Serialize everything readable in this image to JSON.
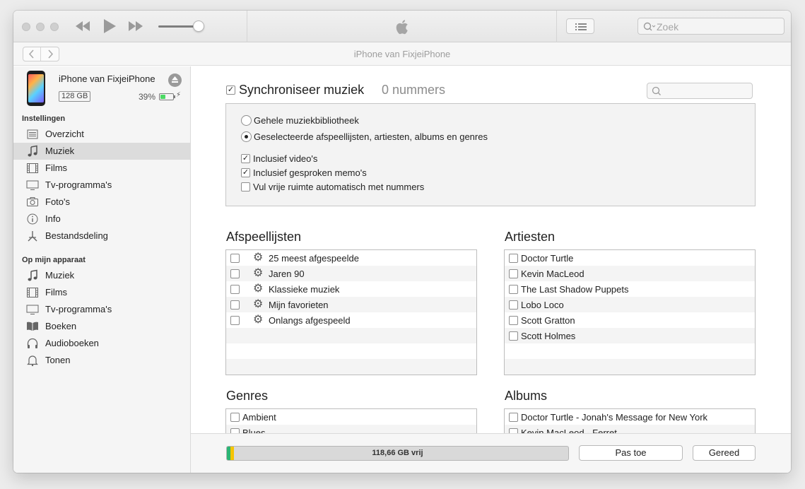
{
  "toolbar": {
    "search_placeholder": "Zoek",
    "volume_level": 0.95
  },
  "navbar": {
    "title": "iPhone van FixjeiPhone",
    "back_icon": "chevron-left-icon",
    "forward_icon": "chevron-right-icon"
  },
  "device": {
    "name": "iPhone van FixjeiPhone",
    "capacity": "128 GB",
    "battery_percent": "39%",
    "battery_level": 0.39
  },
  "sidebar": {
    "settings_heading": "Instellingen",
    "settings_items": [
      {
        "label": "Overzicht",
        "icon": "list-icon"
      },
      {
        "label": "Muziek",
        "icon": "music-note-icon",
        "selected": true
      },
      {
        "label": "Films",
        "icon": "film-icon"
      },
      {
        "label": "Tv-programma's",
        "icon": "tv-icon"
      },
      {
        "label": "Foto's",
        "icon": "camera-icon"
      },
      {
        "label": "Info",
        "icon": "info-icon"
      },
      {
        "label": "Bestandsdeling",
        "icon": "app-sharing-icon"
      }
    ],
    "device_heading": "Op mijn apparaat",
    "device_items": [
      {
        "label": "Muziek",
        "icon": "music-note-icon"
      },
      {
        "label": "Films",
        "icon": "film-icon"
      },
      {
        "label": "Tv-programma's",
        "icon": "tv-icon"
      },
      {
        "label": "Boeken",
        "icon": "book-icon"
      },
      {
        "label": "Audioboeken",
        "icon": "headphones-icon"
      },
      {
        "label": "Tonen",
        "icon": "bell-icon"
      }
    ]
  },
  "main": {
    "sync_label": "Synchroniseer muziek",
    "sync_checked": true,
    "sync_count": "0 nummers",
    "radio_options": [
      {
        "label": "Gehele muziekbibliotheek",
        "selected": false
      },
      {
        "label": "Geselecteerde afspeellijsten, artiesten, albums en genres",
        "selected": true
      }
    ],
    "check_options": [
      {
        "label": "Inclusief video's",
        "checked": true
      },
      {
        "label": "Inclusief gesproken memo's",
        "checked": true
      },
      {
        "label": "Vul vrije ruimte automatisch met nummers",
        "checked": false
      }
    ],
    "playlists": {
      "title": "Afspeellijsten",
      "items": [
        "25 meest afgespeelde",
        "Jaren 90",
        "Klassieke muziek",
        "Mijn favorieten",
        "Onlangs afgespeeld"
      ]
    },
    "artists": {
      "title": "Artiesten",
      "items": [
        "Doctor Turtle",
        "Kevin MacLeod",
        "The Last Shadow Puppets",
        "Lobo Loco",
        "Scott Gratton",
        "Scott Holmes"
      ]
    },
    "genres": {
      "title": "Genres",
      "items": [
        "Ambient",
        "Blues"
      ]
    },
    "albums": {
      "title": "Albums",
      "items": [
        "Doctor Turtle - Jonah's Message for New York",
        "Kevin MacLeod - Ferret"
      ]
    }
  },
  "bottom": {
    "storage_label": "118,66 GB vrij",
    "storage_colors": [
      "#2bb673",
      "#f5c400"
    ],
    "apply_label": "Pas toe",
    "done_label": "Gereed"
  }
}
